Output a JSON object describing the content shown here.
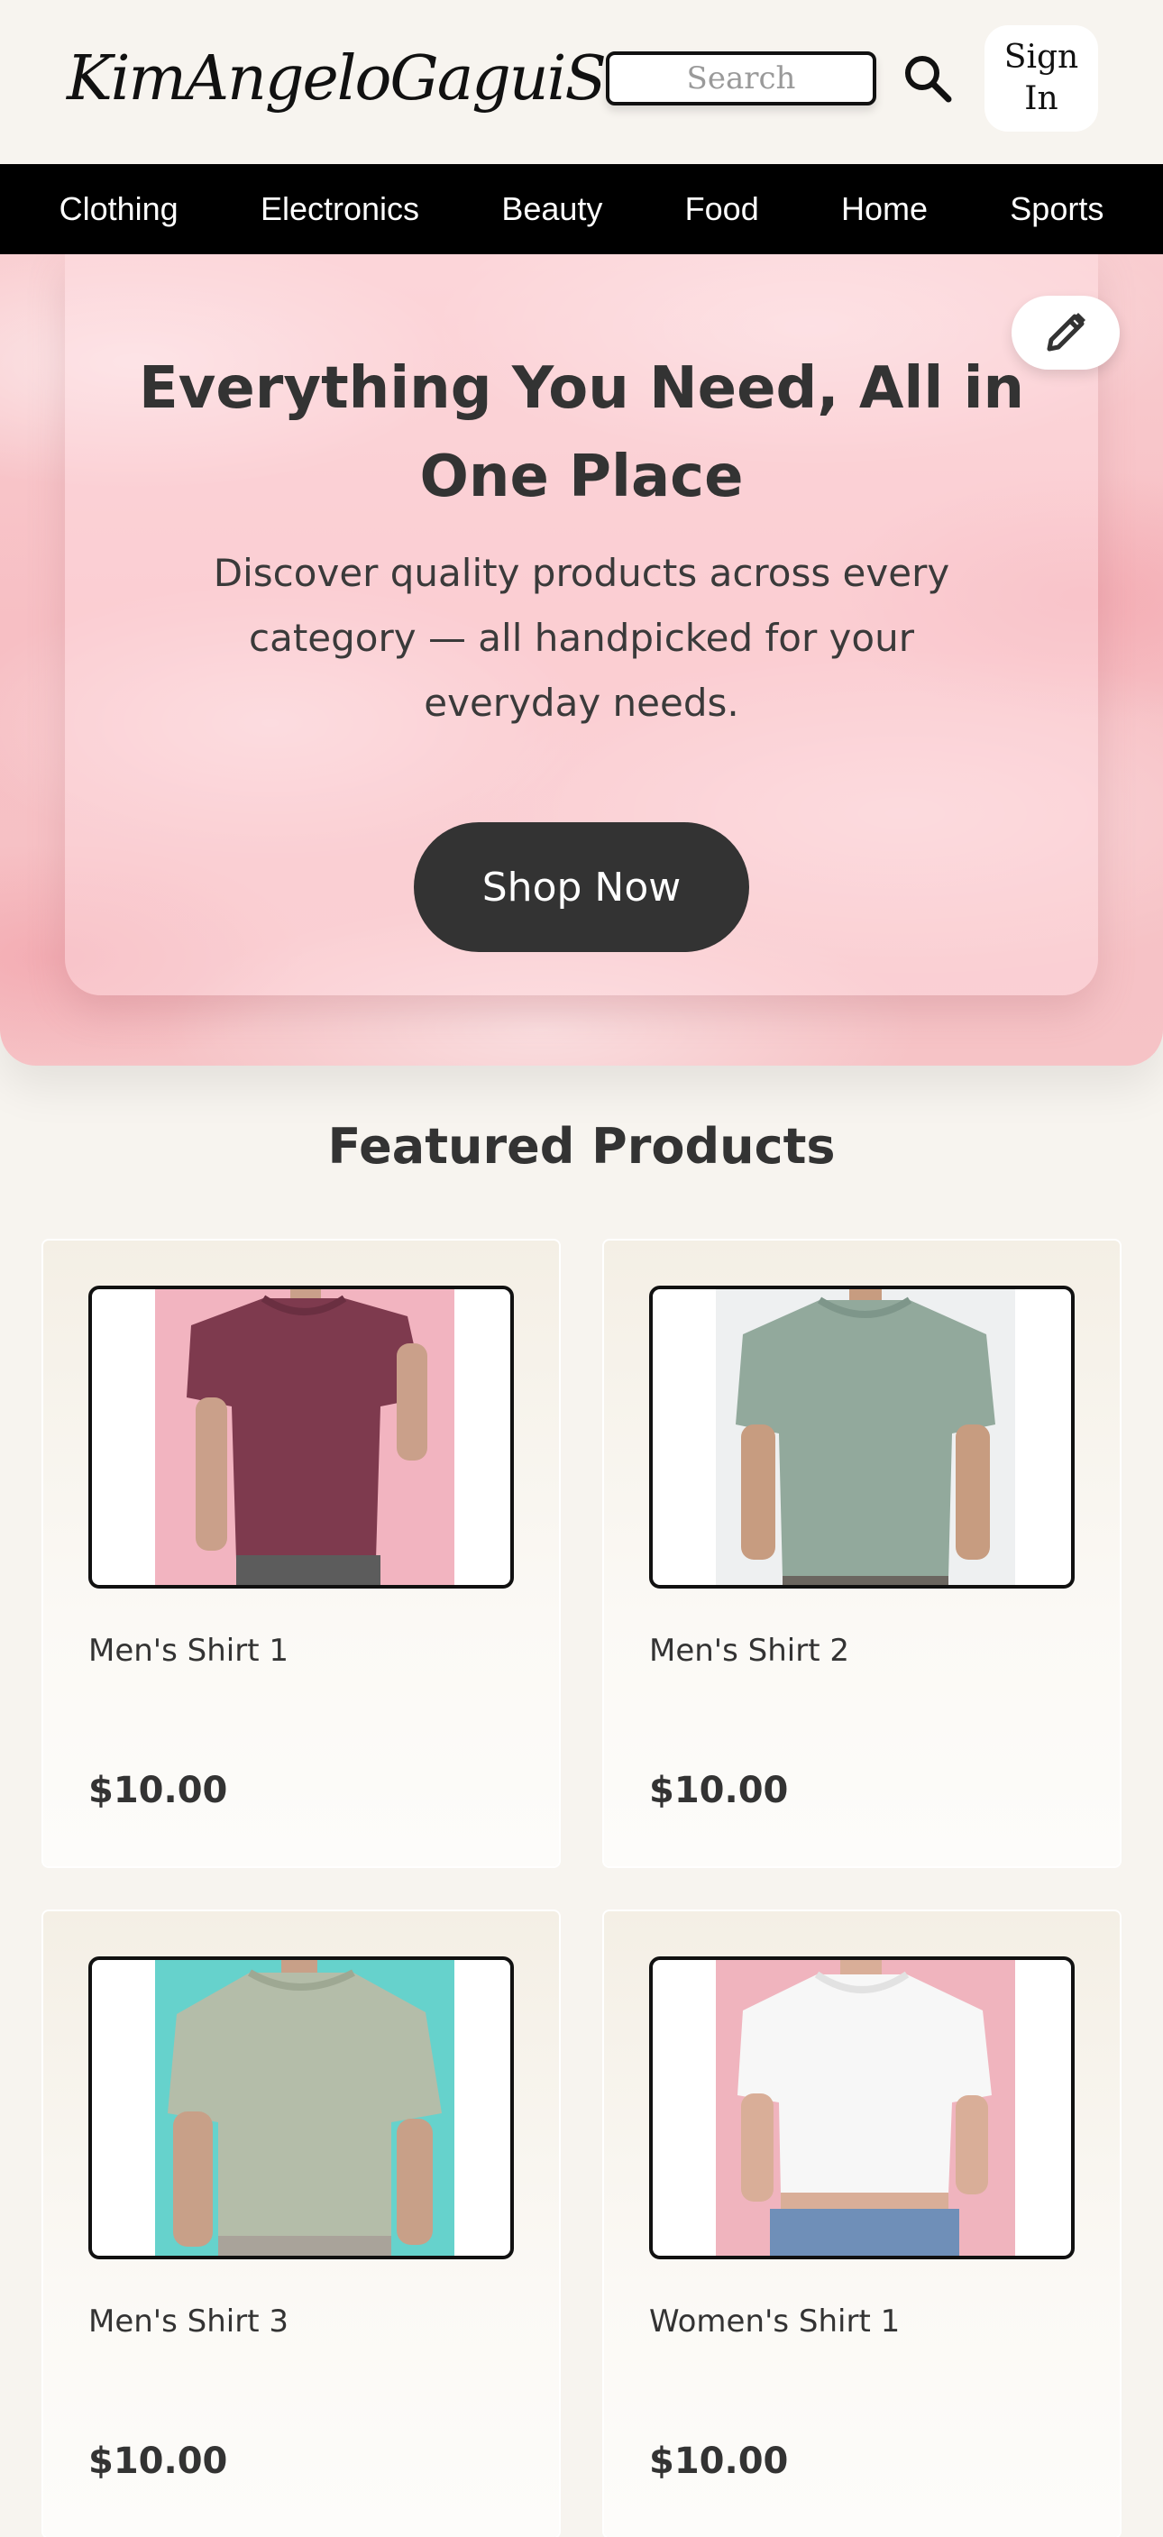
{
  "header": {
    "logo": "KimAngeloGaguiStore",
    "search_placeholder": "Search",
    "search_icon": "search-icon",
    "signin_label": "Sign In"
  },
  "nav": {
    "items": [
      {
        "label": "Clothing"
      },
      {
        "label": "Electronics"
      },
      {
        "label": "Beauty"
      },
      {
        "label": "Food"
      },
      {
        "label": "Home"
      },
      {
        "label": "Sports"
      }
    ]
  },
  "hero": {
    "title": "Everything You Need, All in One Place",
    "subtitle": "Discover quality products across every category — all handpicked for your everyday needs.",
    "cta_label": "Shop Now",
    "edit_icon": "pencil-icon"
  },
  "featured": {
    "title": "Featured Products",
    "products": [
      {
        "name": "Men's Shirt 1",
        "price": "$10.00",
        "shirt_color": "#7e3a4e",
        "backdrop": "#f2b4c0"
      },
      {
        "name": "Men's Shirt 2",
        "price": "$10.00",
        "shirt_color": "#92a99c",
        "backdrop": "#eef0f1"
      },
      {
        "name": "Men's Shirt 3",
        "price": "$10.00",
        "shirt_color": "#b4bda9",
        "backdrop": "#66d2cc"
      },
      {
        "name": "Women's Shirt 1",
        "price": "$10.00",
        "shirt_color": "#f7f7f7",
        "backdrop": "#f0b4be"
      }
    ]
  },
  "colors": {
    "page_background": "#f7f4ef",
    "nav_background": "#000000",
    "hero_pink": "#f7bfc4",
    "button_dark": "#333333"
  }
}
